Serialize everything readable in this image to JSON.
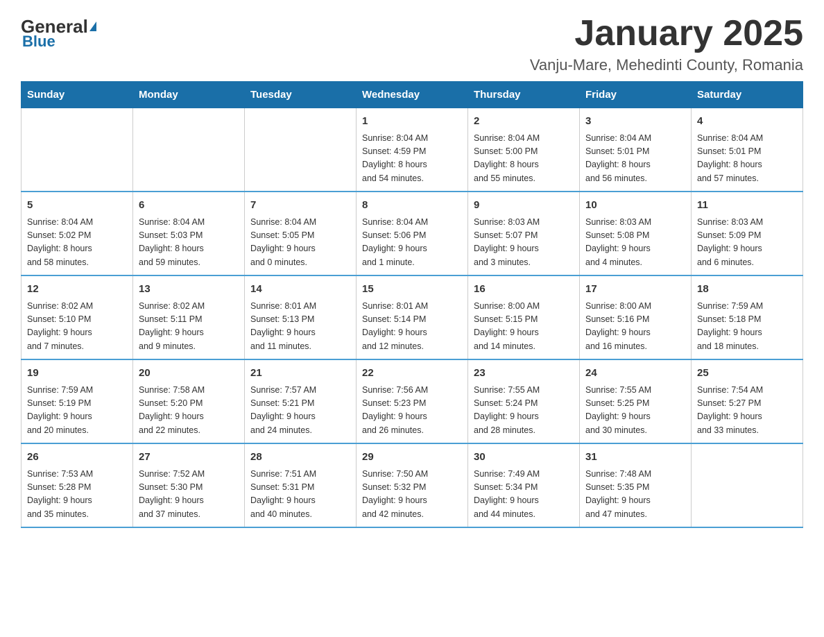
{
  "header": {
    "logo": {
      "general": "General",
      "blue": "Blue",
      "triangle_color": "#1a6fa8"
    },
    "title": "January 2025",
    "location": "Vanju-Mare, Mehedinti County, Romania"
  },
  "calendar": {
    "header_color": "#1a6fa8",
    "days_of_week": [
      "Sunday",
      "Monday",
      "Tuesday",
      "Wednesday",
      "Thursday",
      "Friday",
      "Saturday"
    ],
    "weeks": [
      [
        {
          "day": "",
          "info": ""
        },
        {
          "day": "",
          "info": ""
        },
        {
          "day": "",
          "info": ""
        },
        {
          "day": "1",
          "info": "Sunrise: 8:04 AM\nSunset: 4:59 PM\nDaylight: 8 hours\nand 54 minutes."
        },
        {
          "day": "2",
          "info": "Sunrise: 8:04 AM\nSunset: 5:00 PM\nDaylight: 8 hours\nand 55 minutes."
        },
        {
          "day": "3",
          "info": "Sunrise: 8:04 AM\nSunset: 5:01 PM\nDaylight: 8 hours\nand 56 minutes."
        },
        {
          "day": "4",
          "info": "Sunrise: 8:04 AM\nSunset: 5:01 PM\nDaylight: 8 hours\nand 57 minutes."
        }
      ],
      [
        {
          "day": "5",
          "info": "Sunrise: 8:04 AM\nSunset: 5:02 PM\nDaylight: 8 hours\nand 58 minutes."
        },
        {
          "day": "6",
          "info": "Sunrise: 8:04 AM\nSunset: 5:03 PM\nDaylight: 8 hours\nand 59 minutes."
        },
        {
          "day": "7",
          "info": "Sunrise: 8:04 AM\nSunset: 5:05 PM\nDaylight: 9 hours\nand 0 minutes."
        },
        {
          "day": "8",
          "info": "Sunrise: 8:04 AM\nSunset: 5:06 PM\nDaylight: 9 hours\nand 1 minute."
        },
        {
          "day": "9",
          "info": "Sunrise: 8:03 AM\nSunset: 5:07 PM\nDaylight: 9 hours\nand 3 minutes."
        },
        {
          "day": "10",
          "info": "Sunrise: 8:03 AM\nSunset: 5:08 PM\nDaylight: 9 hours\nand 4 minutes."
        },
        {
          "day": "11",
          "info": "Sunrise: 8:03 AM\nSunset: 5:09 PM\nDaylight: 9 hours\nand 6 minutes."
        }
      ],
      [
        {
          "day": "12",
          "info": "Sunrise: 8:02 AM\nSunset: 5:10 PM\nDaylight: 9 hours\nand 7 minutes."
        },
        {
          "day": "13",
          "info": "Sunrise: 8:02 AM\nSunset: 5:11 PM\nDaylight: 9 hours\nand 9 minutes."
        },
        {
          "day": "14",
          "info": "Sunrise: 8:01 AM\nSunset: 5:13 PM\nDaylight: 9 hours\nand 11 minutes."
        },
        {
          "day": "15",
          "info": "Sunrise: 8:01 AM\nSunset: 5:14 PM\nDaylight: 9 hours\nand 12 minutes."
        },
        {
          "day": "16",
          "info": "Sunrise: 8:00 AM\nSunset: 5:15 PM\nDaylight: 9 hours\nand 14 minutes."
        },
        {
          "day": "17",
          "info": "Sunrise: 8:00 AM\nSunset: 5:16 PM\nDaylight: 9 hours\nand 16 minutes."
        },
        {
          "day": "18",
          "info": "Sunrise: 7:59 AM\nSunset: 5:18 PM\nDaylight: 9 hours\nand 18 minutes."
        }
      ],
      [
        {
          "day": "19",
          "info": "Sunrise: 7:59 AM\nSunset: 5:19 PM\nDaylight: 9 hours\nand 20 minutes."
        },
        {
          "day": "20",
          "info": "Sunrise: 7:58 AM\nSunset: 5:20 PM\nDaylight: 9 hours\nand 22 minutes."
        },
        {
          "day": "21",
          "info": "Sunrise: 7:57 AM\nSunset: 5:21 PM\nDaylight: 9 hours\nand 24 minutes."
        },
        {
          "day": "22",
          "info": "Sunrise: 7:56 AM\nSunset: 5:23 PM\nDaylight: 9 hours\nand 26 minutes."
        },
        {
          "day": "23",
          "info": "Sunrise: 7:55 AM\nSunset: 5:24 PM\nDaylight: 9 hours\nand 28 minutes."
        },
        {
          "day": "24",
          "info": "Sunrise: 7:55 AM\nSunset: 5:25 PM\nDaylight: 9 hours\nand 30 minutes."
        },
        {
          "day": "25",
          "info": "Sunrise: 7:54 AM\nSunset: 5:27 PM\nDaylight: 9 hours\nand 33 minutes."
        }
      ],
      [
        {
          "day": "26",
          "info": "Sunrise: 7:53 AM\nSunset: 5:28 PM\nDaylight: 9 hours\nand 35 minutes."
        },
        {
          "day": "27",
          "info": "Sunrise: 7:52 AM\nSunset: 5:30 PM\nDaylight: 9 hours\nand 37 minutes."
        },
        {
          "day": "28",
          "info": "Sunrise: 7:51 AM\nSunset: 5:31 PM\nDaylight: 9 hours\nand 40 minutes."
        },
        {
          "day": "29",
          "info": "Sunrise: 7:50 AM\nSunset: 5:32 PM\nDaylight: 9 hours\nand 42 minutes."
        },
        {
          "day": "30",
          "info": "Sunrise: 7:49 AM\nSunset: 5:34 PM\nDaylight: 9 hours\nand 44 minutes."
        },
        {
          "day": "31",
          "info": "Sunrise: 7:48 AM\nSunset: 5:35 PM\nDaylight: 9 hours\nand 47 minutes."
        },
        {
          "day": "",
          "info": ""
        }
      ]
    ]
  }
}
